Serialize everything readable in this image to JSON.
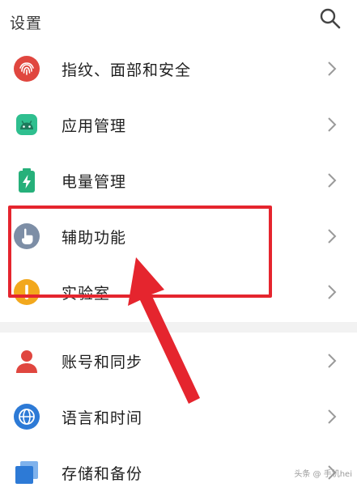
{
  "header": {
    "title": "设置",
    "search_icon": "search-icon"
  },
  "group_top": [
    {
      "label": "指纹、面部和安全",
      "icon": "fingerprint-icon",
      "color": "#e0463f"
    },
    {
      "label": "应用管理",
      "icon": "android-icon",
      "color": "#2fbf8f"
    },
    {
      "label": "电量管理",
      "icon": "battery-icon",
      "color": "#26b07a"
    },
    {
      "label": "辅助功能",
      "icon": "hand-touch-icon",
      "color": "#7d8ea6"
    },
    {
      "label": "实验室",
      "icon": "lab-icon",
      "color": "#f2a81d"
    }
  ],
  "group_bottom": [
    {
      "label": "账号和同步",
      "icon": "person-icon",
      "color": "#e0463f"
    },
    {
      "label": "语言和时间",
      "icon": "globe-icon",
      "color": "#2d7ad6"
    },
    {
      "label": "存储和备份",
      "icon": "storage-icon",
      "color": "#2d7ad6"
    }
  ],
  "annotation": {
    "highlight_color": "#e5252e"
  },
  "watermark": "头条 @ 手机hei"
}
